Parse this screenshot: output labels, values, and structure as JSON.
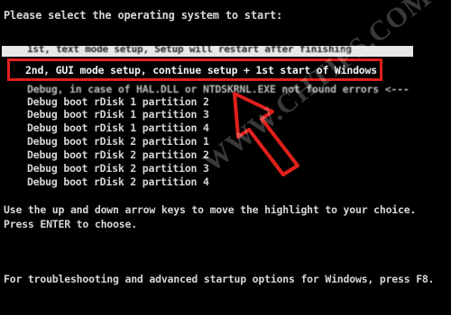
{
  "boot_menu": {
    "heading": "Please select the operating system to start:",
    "highlighted_item_obscured": "1st, text mode setup, Setup will restart after finishing",
    "boxed_item": "2nd, GUI mode setup, continue setup + 1st start of Windows",
    "obscured_item": "Debug, in case of HAL.DLL or NTDSKRNL.EXE not found errors <---",
    "items": [
      "Debug boot rDisk 1 partition 2",
      "Debug boot rDisk 1 partition 3",
      "Debug boot rDisk 1 partition 4",
      "Debug boot rDisk 2 partition 1",
      "Debug boot rDisk 2 partition 2",
      "Debug boot rDisk 2 partition 3",
      "Debug boot rDisk 2 partition 4"
    ],
    "instructions_1": "Use the up and down arrow keys to move the highlight to your choice.",
    "instructions_2": "Press ENTER to choose.",
    "footer": "For troubleshooting and advanced startup options for Windows, press F8."
  },
  "annotation": {
    "box_color": "#e0201c",
    "arrow_color": "#e0201c",
    "watermark": "WWW.CHTIPS.COM"
  }
}
